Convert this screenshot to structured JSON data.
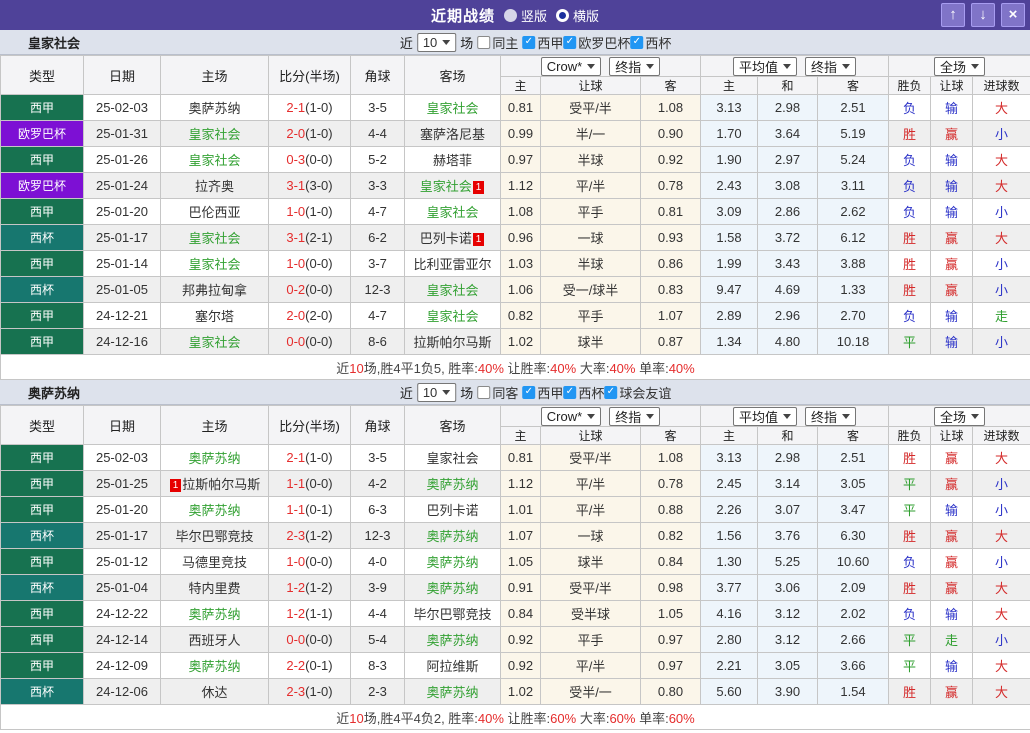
{
  "titlebar": {
    "title": "近期战绩",
    "radios": [
      {
        "label": "竖版",
        "selected": false
      },
      {
        "label": "横版",
        "selected": true
      }
    ],
    "buttons": {
      "up": "↑",
      "down": "↓",
      "close": "×"
    }
  },
  "colors": {
    "titlebar_purple": "#4f4299",
    "liga_badge_green": "#177250",
    "europa_badge_purple": "#7d10d4",
    "copa_badge_teal": "#17776f",
    "focus_team_green": "#33a133",
    "score_red": "#e52d2d",
    "win_red": "#d42a2a",
    "lose_blue": "#2b32c8",
    "draw_green": "#2d9e2d",
    "checkbox_blue": "#2196f3"
  },
  "table_headers": {
    "left": [
      "类型",
      "日期",
      "主场",
      "比分(半场)",
      "角球",
      "客场"
    ],
    "selects": [
      "Crow*",
      "终指",
      "平均值",
      "终指",
      "全场"
    ],
    "sub": [
      "主",
      "让球",
      "客",
      "主",
      "和",
      "客",
      "胜负",
      "让球",
      "进球数"
    ]
  },
  "sections": [
    {
      "team": "皇家社会",
      "filters": {
        "near_label": "近",
        "count": "10",
        "games_label": "场",
        "same_label": "同主",
        "same_checked": false,
        "check_glyph": "✓",
        "leagues": [
          {
            "label": "西甲",
            "checked": true
          },
          {
            "label": "欧罗巴杯",
            "checked": true
          },
          {
            "label": "西杯",
            "checked": true
          }
        ]
      },
      "rows": [
        {
          "type": "西甲",
          "type_color": "liga",
          "date": "25-02-03",
          "home": {
            "name": "奥萨苏纳",
            "green": false
          },
          "score": "2-1",
          "half": "(1-0)",
          "corner": "3-5",
          "away": {
            "name": "皇家社会",
            "green": true
          },
          "odds": [
            "0.81",
            "受平/半",
            "1.08"
          ],
          "avg": [
            "3.13",
            "2.98",
            "2.51"
          ],
          "results": [
            {
              "t": "负",
              "c": "blue"
            },
            {
              "t": "输",
              "c": "blue"
            },
            {
              "t": "大",
              "c": "red"
            }
          ]
        },
        {
          "type": "欧罗巴杯",
          "type_color": "europa",
          "date": "25-01-31",
          "home": {
            "name": "皇家社会",
            "green": true
          },
          "score": "2-0",
          "half": "(1-0)",
          "corner": "4-4",
          "away": {
            "name": "塞萨洛尼基",
            "green": false
          },
          "odds": [
            "0.99",
            "半/一",
            "0.90"
          ],
          "avg": [
            "1.70",
            "3.64",
            "5.19"
          ],
          "results": [
            {
              "t": "胜",
              "c": "red"
            },
            {
              "t": "赢",
              "c": "red"
            },
            {
              "t": "小",
              "c": "blue"
            }
          ]
        },
        {
          "type": "西甲",
          "type_color": "liga",
          "date": "25-01-26",
          "home": {
            "name": "皇家社会",
            "green": true
          },
          "score": "0-3",
          "half": "(0-0)",
          "corner": "5-2",
          "away": {
            "name": "赫塔菲",
            "green": false
          },
          "odds": [
            "0.97",
            "半球",
            "0.92"
          ],
          "avg": [
            "1.90",
            "2.97",
            "5.24"
          ],
          "results": [
            {
              "t": "负",
              "c": "blue"
            },
            {
              "t": "输",
              "c": "blue"
            },
            {
              "t": "大",
              "c": "red"
            }
          ]
        },
        {
          "type": "欧罗巴杯",
          "type_color": "europa",
          "date": "25-01-24",
          "home": {
            "name": "拉齐奥",
            "green": false
          },
          "score": "3-1",
          "half": "(3-0)",
          "corner": "3-3",
          "away": {
            "name": "皇家社会",
            "green": true,
            "badge": "1",
            "badge_pos": "after"
          },
          "odds": [
            "1.12",
            "平/半",
            "0.78"
          ],
          "avg": [
            "2.43",
            "3.08",
            "3.11"
          ],
          "results": [
            {
              "t": "负",
              "c": "blue"
            },
            {
              "t": "输",
              "c": "blue"
            },
            {
              "t": "大",
              "c": "red"
            }
          ]
        },
        {
          "type": "西甲",
          "type_color": "liga",
          "date": "25-01-20",
          "home": {
            "name": "巴伦西亚",
            "green": false
          },
          "score": "1-0",
          "half": "(1-0)",
          "corner": "4-7",
          "away": {
            "name": "皇家社会",
            "green": true
          },
          "odds": [
            "1.08",
            "平手",
            "0.81"
          ],
          "avg": [
            "3.09",
            "2.86",
            "2.62"
          ],
          "results": [
            {
              "t": "负",
              "c": "blue"
            },
            {
              "t": "输",
              "c": "blue"
            },
            {
              "t": "小",
              "c": "blue"
            }
          ]
        },
        {
          "type": "西杯",
          "type_color": "copa",
          "date": "25-01-17",
          "home": {
            "name": "皇家社会",
            "green": true
          },
          "score": "3-1",
          "half": "(2-1)",
          "corner": "6-2",
          "away": {
            "name": "巴列卡诺",
            "green": false,
            "badge": "1",
            "badge_pos": "after"
          },
          "odds": [
            "0.96",
            "一球",
            "0.93"
          ],
          "avg": [
            "1.58",
            "3.72",
            "6.12"
          ],
          "results": [
            {
              "t": "胜",
              "c": "red"
            },
            {
              "t": "赢",
              "c": "red"
            },
            {
              "t": "大",
              "c": "red"
            }
          ]
        },
        {
          "type": "西甲",
          "type_color": "liga",
          "date": "25-01-14",
          "home": {
            "name": "皇家社会",
            "green": true
          },
          "score": "1-0",
          "half": "(0-0)",
          "corner": "3-7",
          "away": {
            "name": "比利亚雷亚尔",
            "green": false
          },
          "odds": [
            "1.03",
            "半球",
            "0.86"
          ],
          "avg": [
            "1.99",
            "3.43",
            "3.88"
          ],
          "results": [
            {
              "t": "胜",
              "c": "red"
            },
            {
              "t": "赢",
              "c": "red"
            },
            {
              "t": "小",
              "c": "blue"
            }
          ]
        },
        {
          "type": "西杯",
          "type_color": "copa",
          "date": "25-01-05",
          "home": {
            "name": "邦弗拉甸拿",
            "green": false
          },
          "score": "0-2",
          "half": "(0-0)",
          "corner": "12-3",
          "away": {
            "name": "皇家社会",
            "green": true
          },
          "odds": [
            "1.06",
            "受一/球半",
            "0.83"
          ],
          "avg": [
            "9.47",
            "4.69",
            "1.33"
          ],
          "results": [
            {
              "t": "胜",
              "c": "red"
            },
            {
              "t": "赢",
              "c": "red"
            },
            {
              "t": "小",
              "c": "blue"
            }
          ]
        },
        {
          "type": "西甲",
          "type_color": "liga",
          "date": "24-12-21",
          "home": {
            "name": "塞尔塔",
            "green": false
          },
          "score": "2-0",
          "half": "(2-0)",
          "corner": "4-7",
          "away": {
            "name": "皇家社会",
            "green": true
          },
          "odds": [
            "0.82",
            "平手",
            "1.07"
          ],
          "avg": [
            "2.89",
            "2.96",
            "2.70"
          ],
          "results": [
            {
              "t": "负",
              "c": "blue"
            },
            {
              "t": "输",
              "c": "blue"
            },
            {
              "t": "走",
              "c": "green"
            }
          ]
        },
        {
          "type": "西甲",
          "type_color": "liga",
          "date": "24-12-16",
          "home": {
            "name": "皇家社会",
            "green": true
          },
          "score": "0-0",
          "half": "(0-0)",
          "corner": "8-6",
          "away": {
            "name": "拉斯帕尔马斯",
            "green": false
          },
          "odds": [
            "1.02",
            "球半",
            "0.87"
          ],
          "avg": [
            "1.34",
            "4.80",
            "10.18"
          ],
          "results": [
            {
              "t": "平",
              "c": "green"
            },
            {
              "t": "输",
              "c": "blue"
            },
            {
              "t": "小",
              "c": "blue"
            }
          ]
        }
      ],
      "summary": [
        {
          "t": "近",
          "red": false
        },
        {
          "t": "10",
          "red": true
        },
        {
          "t": "场,胜4平1负5, 胜率:",
          "red": false
        },
        {
          "t": "40%",
          "red": true
        },
        {
          "t": " 让胜率:",
          "red": false
        },
        {
          "t": "40%",
          "red": true
        },
        {
          "t": " 大率:",
          "red": false
        },
        {
          "t": "40%",
          "red": true
        },
        {
          "t": " 单率:",
          "red": false
        },
        {
          "t": "40%",
          "red": true
        }
      ]
    },
    {
      "team": "奥萨苏纳",
      "filters": {
        "near_label": "近",
        "count": "10",
        "games_label": "场",
        "same_label": "同客",
        "same_checked": false,
        "check_glyph": "✓",
        "leagues": [
          {
            "label": "西甲",
            "checked": true
          },
          {
            "label": "西杯",
            "checked": true
          },
          {
            "label": "球会友谊",
            "checked": true
          }
        ]
      },
      "rows": [
        {
          "type": "西甲",
          "type_color": "liga",
          "date": "25-02-03",
          "home": {
            "name": "奥萨苏纳",
            "green": true
          },
          "score": "2-1",
          "half": "(1-0)",
          "corner": "3-5",
          "away": {
            "name": "皇家社会",
            "green": false
          },
          "odds": [
            "0.81",
            "受平/半",
            "1.08"
          ],
          "avg": [
            "3.13",
            "2.98",
            "2.51"
          ],
          "results": [
            {
              "t": "胜",
              "c": "red"
            },
            {
              "t": "赢",
              "c": "red"
            },
            {
              "t": "大",
              "c": "red"
            }
          ]
        },
        {
          "type": "西甲",
          "type_color": "liga",
          "date": "25-01-25",
          "home": {
            "name": "拉斯帕尔马斯",
            "green": false,
            "badge": "1",
            "badge_pos": "before"
          },
          "score": "1-1",
          "half": "(0-0)",
          "corner": "4-2",
          "away": {
            "name": "奥萨苏纳",
            "green": true
          },
          "odds": [
            "1.12",
            "平/半",
            "0.78"
          ],
          "avg": [
            "2.45",
            "3.14",
            "3.05"
          ],
          "results": [
            {
              "t": "平",
              "c": "green"
            },
            {
              "t": "赢",
              "c": "red"
            },
            {
              "t": "小",
              "c": "blue"
            }
          ]
        },
        {
          "type": "西甲",
          "type_color": "liga",
          "date": "25-01-20",
          "home": {
            "name": "奥萨苏纳",
            "green": true
          },
          "score": "1-1",
          "half": "(0-1)",
          "corner": "6-3",
          "away": {
            "name": "巴列卡诺",
            "green": false
          },
          "odds": [
            "1.01",
            "平/半",
            "0.88"
          ],
          "avg": [
            "2.26",
            "3.07",
            "3.47"
          ],
          "results": [
            {
              "t": "平",
              "c": "green"
            },
            {
              "t": "输",
              "c": "blue"
            },
            {
              "t": "小",
              "c": "blue"
            }
          ]
        },
        {
          "type": "西杯",
          "type_color": "copa",
          "date": "25-01-17",
          "home": {
            "name": "毕尔巴鄂竞技",
            "green": false
          },
          "score": "2-3",
          "half": "(1-2)",
          "corner": "12-3",
          "away": {
            "name": "奥萨苏纳",
            "green": true
          },
          "odds": [
            "1.07",
            "一球",
            "0.82"
          ],
          "avg": [
            "1.56",
            "3.76",
            "6.30"
          ],
          "results": [
            {
              "t": "胜",
              "c": "red"
            },
            {
              "t": "赢",
              "c": "red"
            },
            {
              "t": "大",
              "c": "red"
            }
          ]
        },
        {
          "type": "西甲",
          "type_color": "liga",
          "date": "25-01-12",
          "home": {
            "name": "马德里竞技",
            "green": false
          },
          "score": "1-0",
          "half": "(0-0)",
          "corner": "4-0",
          "away": {
            "name": "奥萨苏纳",
            "green": true
          },
          "odds": [
            "1.05",
            "球半",
            "0.84"
          ],
          "avg": [
            "1.30",
            "5.25",
            "10.60"
          ],
          "results": [
            {
              "t": "负",
              "c": "blue"
            },
            {
              "t": "赢",
              "c": "red"
            },
            {
              "t": "小",
              "c": "blue"
            }
          ]
        },
        {
          "type": "西杯",
          "type_color": "copa",
          "date": "25-01-04",
          "home": {
            "name": "特内里费",
            "green": false
          },
          "score": "1-2",
          "half": "(1-2)",
          "corner": "3-9",
          "away": {
            "name": "奥萨苏纳",
            "green": true
          },
          "odds": [
            "0.91",
            "受平/半",
            "0.98"
          ],
          "avg": [
            "3.77",
            "3.06",
            "2.09"
          ],
          "results": [
            {
              "t": "胜",
              "c": "red"
            },
            {
              "t": "赢",
              "c": "red"
            },
            {
              "t": "大",
              "c": "red"
            }
          ]
        },
        {
          "type": "西甲",
          "type_color": "liga",
          "date": "24-12-22",
          "home": {
            "name": "奥萨苏纳",
            "green": true
          },
          "score": "1-2",
          "half": "(1-1)",
          "corner": "4-4",
          "away": {
            "name": "毕尔巴鄂竞技",
            "green": false
          },
          "odds": [
            "0.84",
            "受半球",
            "1.05"
          ],
          "avg": [
            "4.16",
            "3.12",
            "2.02"
          ],
          "results": [
            {
              "t": "负",
              "c": "blue"
            },
            {
              "t": "输",
              "c": "blue"
            },
            {
              "t": "大",
              "c": "red"
            }
          ]
        },
        {
          "type": "西甲",
          "type_color": "liga",
          "date": "24-12-14",
          "home": {
            "name": "西班牙人",
            "green": false
          },
          "score": "0-0",
          "half": "(0-0)",
          "corner": "5-4",
          "away": {
            "name": "奥萨苏纳",
            "green": true
          },
          "odds": [
            "0.92",
            "平手",
            "0.97"
          ],
          "avg": [
            "2.80",
            "3.12",
            "2.66"
          ],
          "results": [
            {
              "t": "平",
              "c": "green"
            },
            {
              "t": "走",
              "c": "green"
            },
            {
              "t": "小",
              "c": "blue"
            }
          ]
        },
        {
          "type": "西甲",
          "type_color": "liga",
          "date": "24-12-09",
          "home": {
            "name": "奥萨苏纳",
            "green": true
          },
          "score": "2-2",
          "half": "(0-1)",
          "corner": "8-3",
          "away": {
            "name": "阿拉维斯",
            "green": false
          },
          "odds": [
            "0.92",
            "平/半",
            "0.97"
          ],
          "avg": [
            "2.21",
            "3.05",
            "3.66"
          ],
          "results": [
            {
              "t": "平",
              "c": "green"
            },
            {
              "t": "输",
              "c": "blue"
            },
            {
              "t": "大",
              "c": "red"
            }
          ]
        },
        {
          "type": "西杯",
          "type_color": "copa",
          "date": "24-12-06",
          "home": {
            "name": "休达",
            "green": false
          },
          "score": "2-3",
          "half": "(1-0)",
          "corner": "2-3",
          "away": {
            "name": "奥萨苏纳",
            "green": true
          },
          "odds": [
            "1.02",
            "受半/一",
            "0.80"
          ],
          "avg": [
            "5.60",
            "3.90",
            "1.54"
          ],
          "results": [
            {
              "t": "胜",
              "c": "red"
            },
            {
              "t": "赢",
              "c": "red"
            },
            {
              "t": "大",
              "c": "red"
            }
          ]
        }
      ],
      "summary": [
        {
          "t": "近",
          "red": false
        },
        {
          "t": "10",
          "red": true
        },
        {
          "t": "场,胜4平4负2, 胜率:",
          "red": false
        },
        {
          "t": "40%",
          "red": true
        },
        {
          "t": " 让胜率:",
          "red": false
        },
        {
          "t": "60%",
          "red": true
        },
        {
          "t": " 大率:",
          "red": false
        },
        {
          "t": "60%",
          "red": true
        },
        {
          "t": " 单率:",
          "red": false
        },
        {
          "t": "60%",
          "red": true
        }
      ]
    }
  ]
}
